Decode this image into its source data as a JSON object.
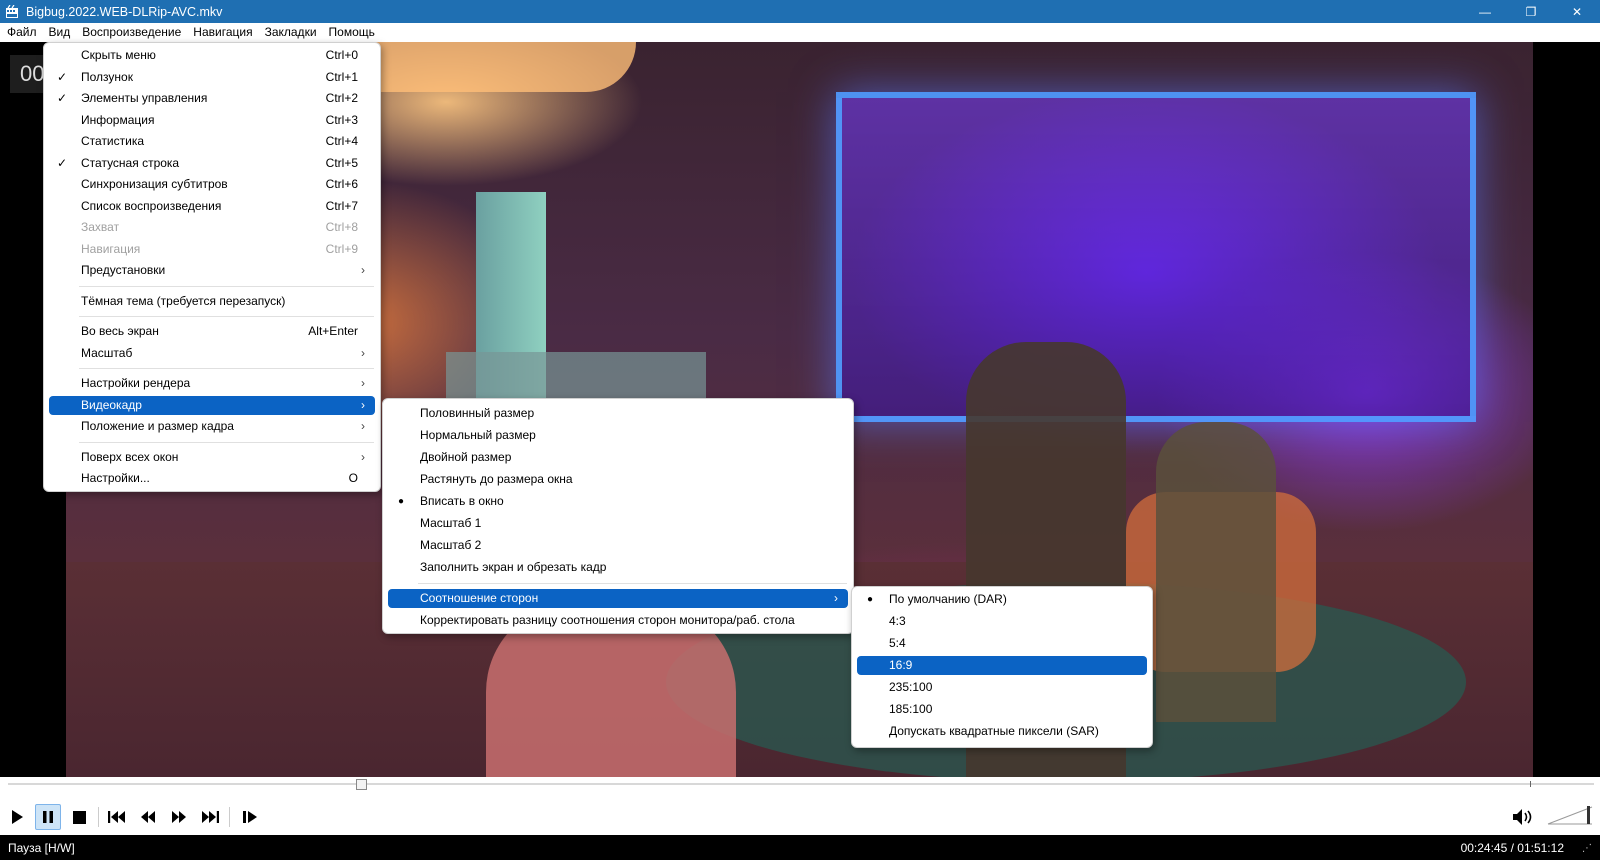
{
  "window": {
    "title": "Bigbug.2022.WEB-DLRip-AVC.mkv",
    "controls": {
      "minimize": "—",
      "restore": "❐",
      "close": "✕"
    }
  },
  "menubar": [
    "Файл",
    "Вид",
    "Воспроизведение",
    "Навигация",
    "Закладки",
    "Помощь"
  ],
  "left_overlay": "00",
  "view_menu": {
    "items": [
      {
        "label": "Скрыть меню",
        "shortcut": "Ctrl+0"
      },
      {
        "label": "Ползунок",
        "shortcut": "Ctrl+1",
        "checked": "✓"
      },
      {
        "label": "Элементы управления",
        "shortcut": "Ctrl+2",
        "checked": "✓"
      },
      {
        "label": "Информация",
        "shortcut": "Ctrl+3"
      },
      {
        "label": "Статистика",
        "shortcut": "Ctrl+4"
      },
      {
        "label": "Статусная строка",
        "shortcut": "Ctrl+5",
        "checked": "✓"
      },
      {
        "label": "Синхронизация субтитров",
        "shortcut": "Ctrl+6"
      },
      {
        "label": "Список воспроизведения",
        "shortcut": "Ctrl+7"
      },
      {
        "label": "Захват",
        "shortcut": "Ctrl+8"
      },
      {
        "label": "Навигация",
        "shortcut": "Ctrl+9"
      },
      {
        "label": "Предустановки",
        "arrow": "›"
      },
      {
        "label": "Тёмная тема (требуется перезапуск)"
      },
      {
        "label": "Во весь экран",
        "shortcut": "Alt+Enter"
      },
      {
        "label": "Масштаб",
        "arrow": "›"
      },
      {
        "label": "Настройки рендера",
        "arrow": "›"
      },
      {
        "label": "Видеокадр",
        "arrow": "›"
      },
      {
        "label": "Положение и размер кадра",
        "arrow": "›"
      },
      {
        "label": "Поверх всех окон",
        "arrow": "›"
      },
      {
        "label": "Настройки...",
        "shortcut": "O"
      }
    ]
  },
  "videoframe_menu": {
    "items": [
      {
        "label": "Половинный размер"
      },
      {
        "label": "Нормальный размер"
      },
      {
        "label": "Двойной размер"
      },
      {
        "label": "Растянуть до размера окна"
      },
      {
        "label": "Вписать в окно",
        "radio": "●"
      },
      {
        "label": "Масштаб 1"
      },
      {
        "label": "Масштаб 2"
      },
      {
        "label": "Заполнить экран и обрезать кадр"
      },
      {
        "label": "Соотношение сторон",
        "arrow": "›"
      },
      {
        "label": "Корректировать разницу соотношения сторон монитора/раб. стола"
      }
    ]
  },
  "aspect_menu": {
    "items": [
      {
        "label": "По умолчанию (DAR)",
        "radio": "●"
      },
      {
        "label": "4:3"
      },
      {
        "label": "5:4"
      },
      {
        "label": "16:9"
      },
      {
        "label": "235:100"
      },
      {
        "label": "185:100"
      },
      {
        "label": "Допускать квадратные пиксели (SAR)"
      }
    ]
  },
  "status": {
    "state": "Пауза [H/W]",
    "time": "00:24:45 / 01:51:12"
  },
  "colors": {
    "accent": "#0b63c4",
    "titlebar": "#1f6fb2"
  }
}
